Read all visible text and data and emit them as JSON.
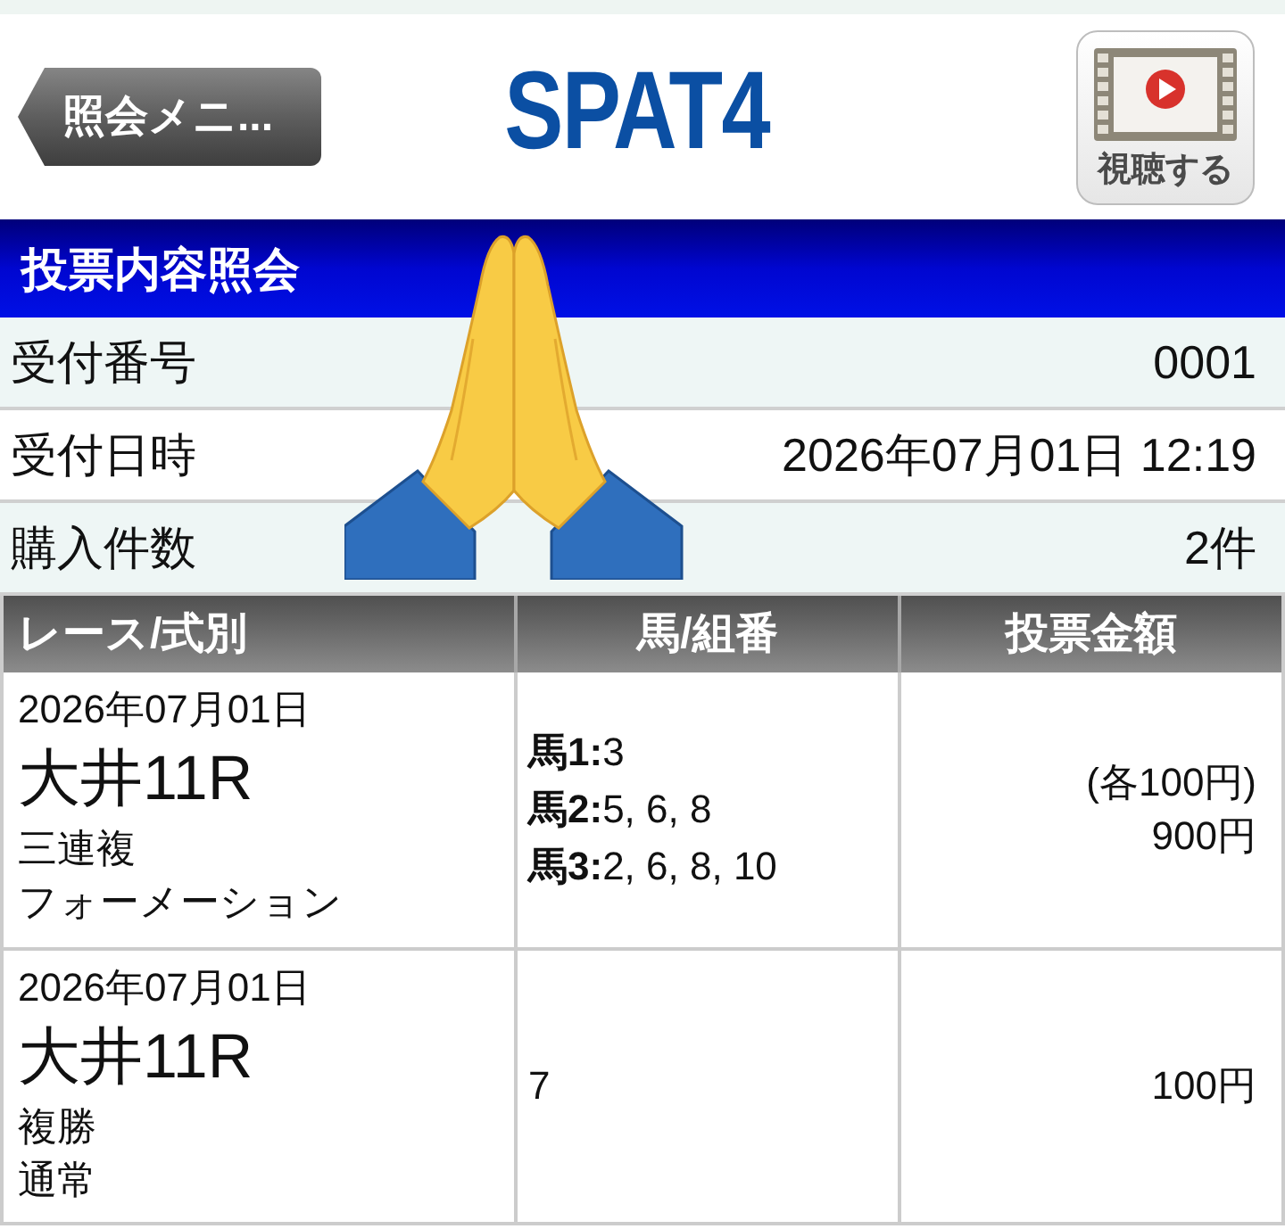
{
  "header": {
    "back_button": "照会メニ...",
    "logo": "SPAT4",
    "watch_button": "視聴する"
  },
  "section": {
    "title": "投票内容照会"
  },
  "summary": [
    {
      "label": "受付番号",
      "value": "0001"
    },
    {
      "label": "受付日時",
      "value": "2026年07月01日 12:19"
    },
    {
      "label": "購入件数",
      "value": "2件"
    }
  ],
  "table": {
    "columns": [
      "レース/式別",
      "馬/組番",
      "投票金額"
    ],
    "rows": [
      {
        "date": "2026年07月01日",
        "race": "大井11R",
        "bet_type": "三連複",
        "method": "フォーメーション",
        "combinations": [
          "**馬1:**3",
          "**馬2:**5, 6, 8",
          "**馬3:**2, 6, 8, 10"
        ],
        "amounts": [
          "(各100円)",
          "900円"
        ]
      },
      {
        "date": "2026年07月01日",
        "race": "大井11R",
        "bet_type": "複勝",
        "method": "通常",
        "combinations": [
          "7"
        ],
        "amounts": [
          "100円"
        ]
      }
    ]
  }
}
